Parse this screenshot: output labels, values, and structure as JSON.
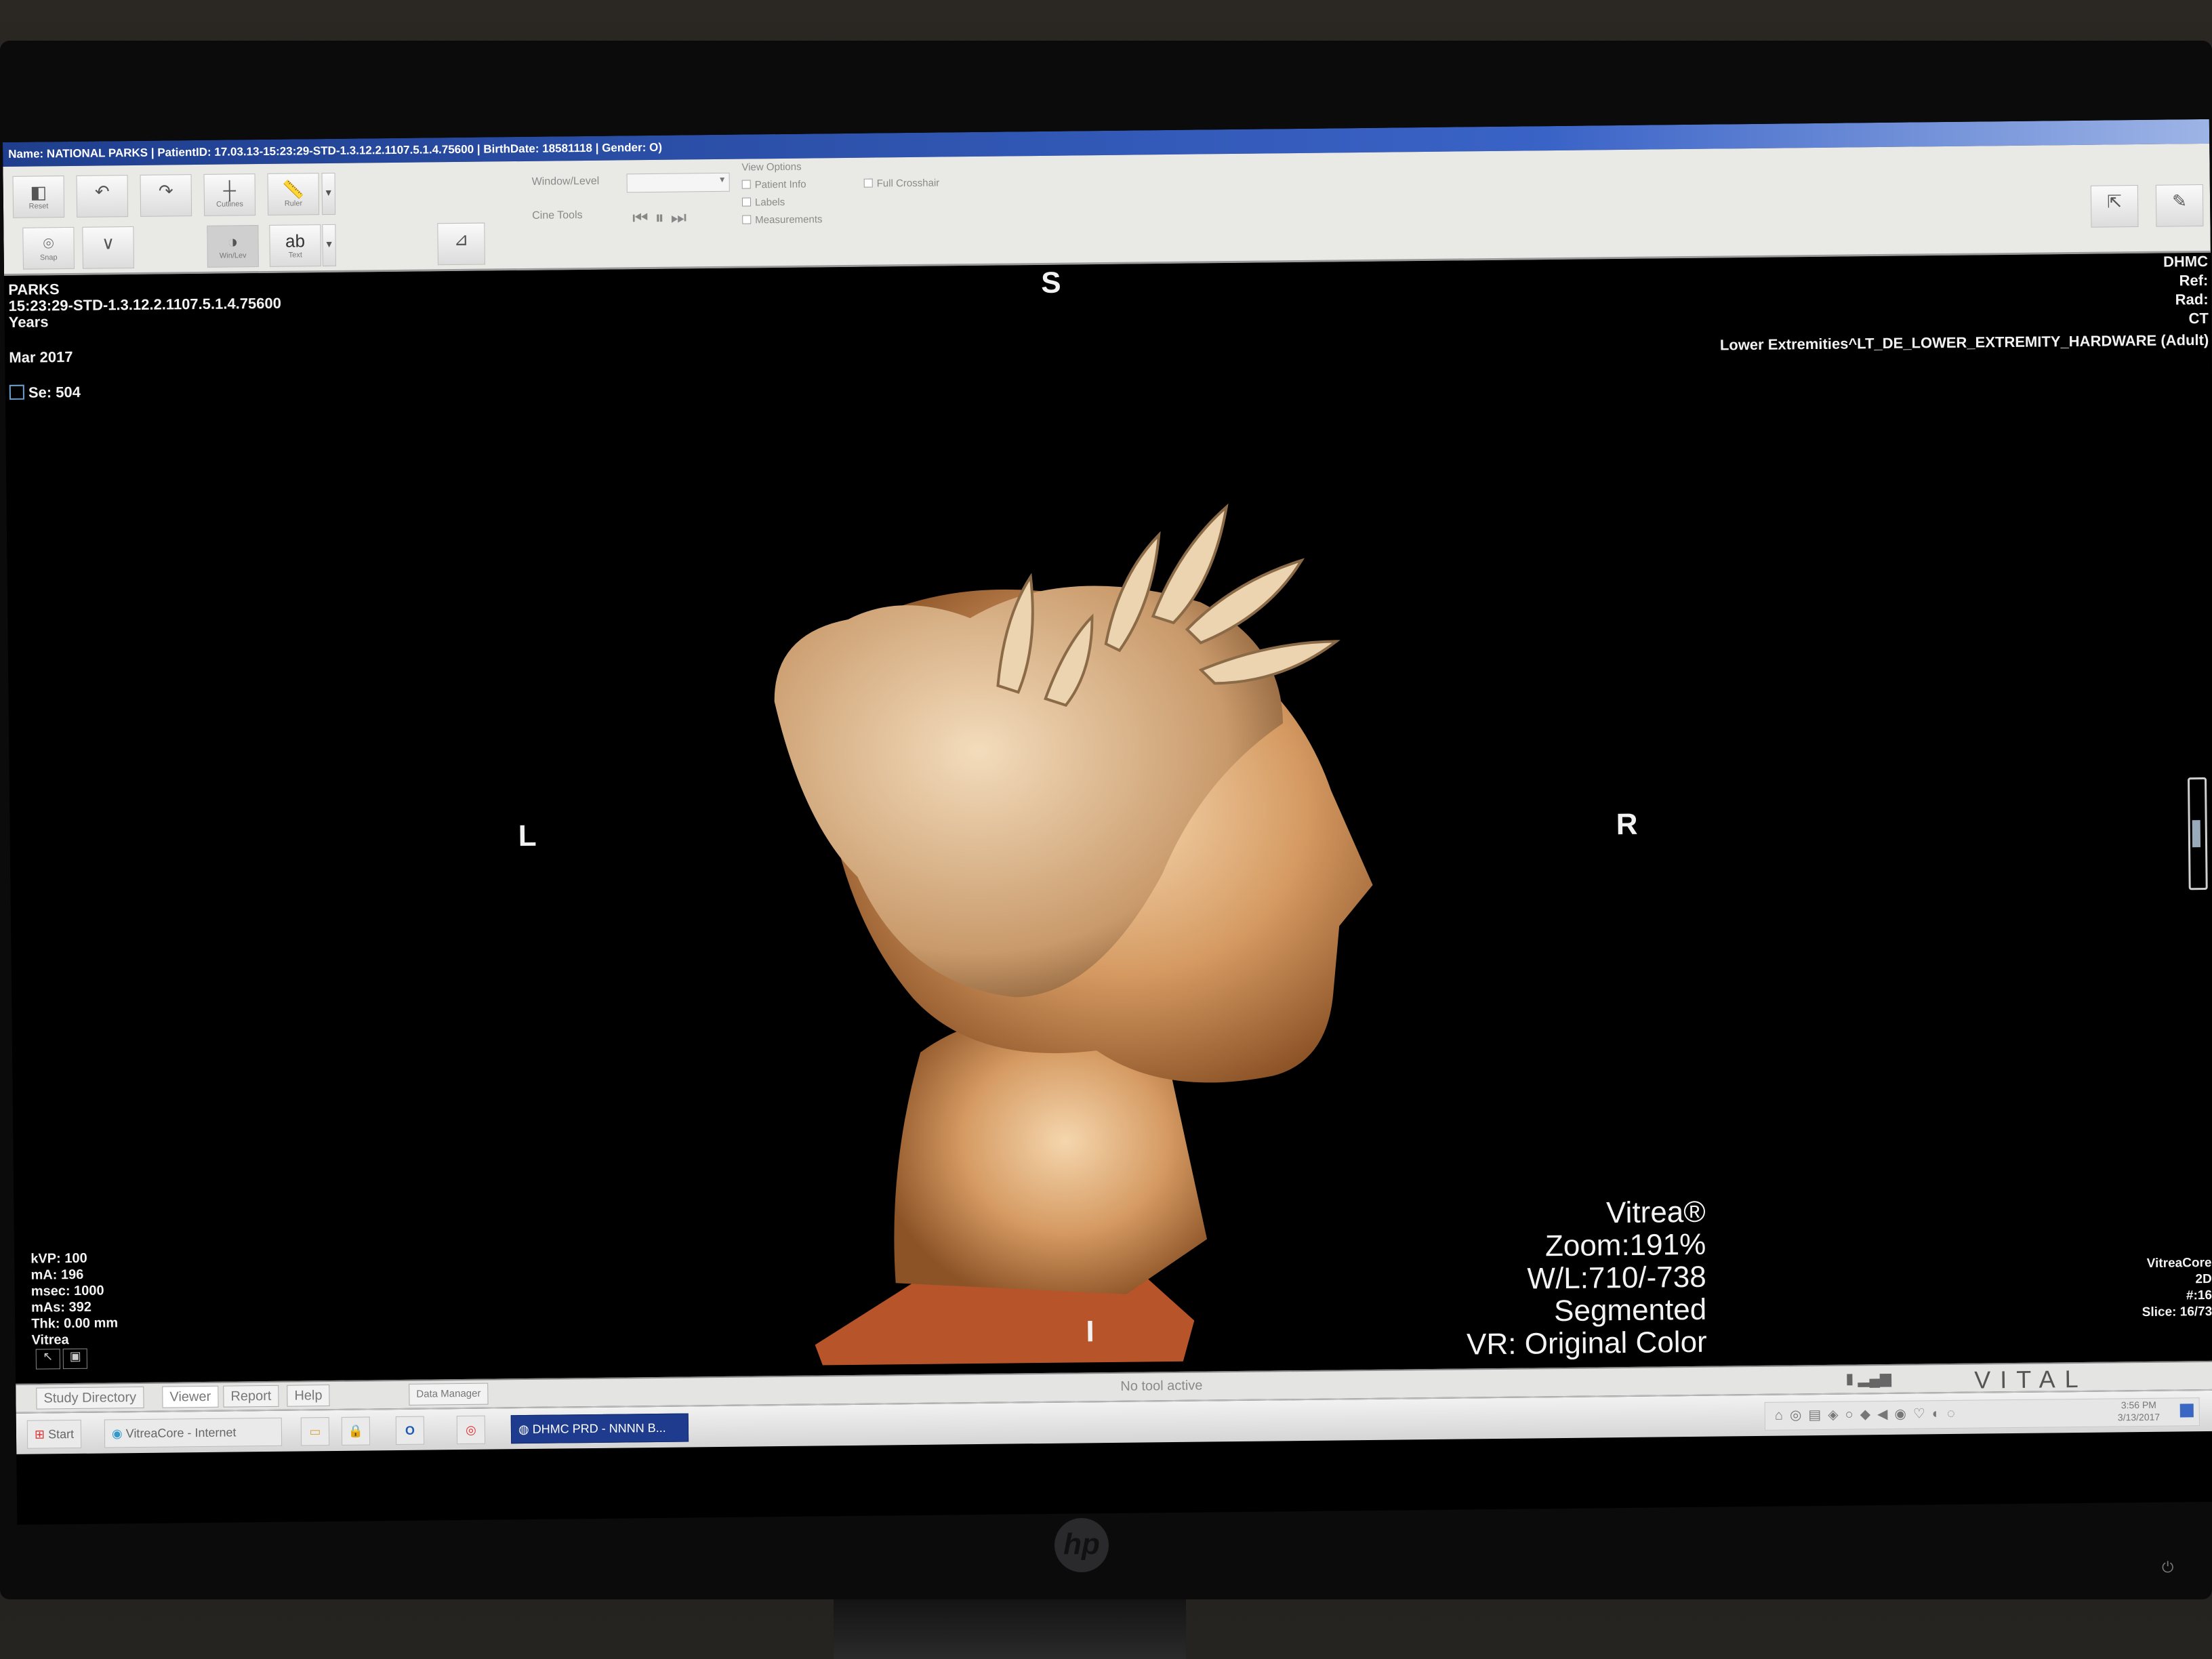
{
  "window": {
    "title": "Name: NATIONAL PARKS | PatientID: 17.03.13-15:23:29-STD-1.3.12.2.1107.5.1.4.75600 | BirthDate: 18581118 | Gender: O)"
  },
  "toolbar": {
    "reset": "Reset",
    "undo": "",
    "redo": "",
    "hotkey1": "Cutlines",
    "hotkey2": "Ruler",
    "snap": "Snap",
    "windowlevel": "Win/Lev",
    "text_icon": "ab",
    "text": "Text",
    "window_level_label": "Window/Level",
    "cine_tools_label": "Cine Tools",
    "view_options_label": "View Options",
    "patient_info": "Patient Info",
    "labels": "Labels",
    "measurements": "Measurements",
    "full_crosshair": "Full Crosshair"
  },
  "overlay": {
    "top_left": {
      "name": "PARKS",
      "id": "15:23:29-STD-1.3.12.2.1107.5.1.4.75600",
      "age": "Years",
      "date": "Mar 2017",
      "series": "Se: 504"
    },
    "top_right": {
      "institution": "DHMC",
      "ref": "Ref:",
      "rad": "Rad:",
      "modality": "CT",
      "protocol": "Lower Extremities^LT_DE_LOWER_EXTREMITY_HARDWARE (Adult)"
    },
    "orientation": {
      "top": "S",
      "left": "L",
      "right": "R",
      "bottom": "I"
    },
    "bottom_left": {
      "kvp": "kVP: 100",
      "ma": "mA: 196",
      "msec": "msec: 1000",
      "mas": "mAs: 392",
      "thk": "Thk: 0.00 mm",
      "vendor": "Vitrea"
    },
    "bottom_center": {
      "brand": "Vitrea®",
      "zoom": "Zoom:191%",
      "wl": "W/L:710/-738",
      "mode": "Segmented",
      "vr": "VR: Original Color"
    },
    "bottom_right": {
      "core": "VitreaCore",
      "dim": "2D",
      "num": "#:16",
      "slice": "Slice: 16/73"
    }
  },
  "tabs": {
    "study_directory": "Study Directory",
    "viewer": "Viewer",
    "report": "Report",
    "help": "Help",
    "data_manager": "Data Manager"
  },
  "status": {
    "message": "No tool active",
    "brand": "VITAL"
  },
  "taskbar": {
    "start": "Start",
    "item1": "VitreaCore - Internet",
    "item2": "DHMC PRD - NNNN B..."
  },
  "tray": {
    "time": "3:56 PM",
    "date": "3/13/2017"
  },
  "monitor": {
    "brand": "hp"
  },
  "colors": {
    "titlebar": "#2b54b6",
    "active_task": "#1e3b8e"
  }
}
